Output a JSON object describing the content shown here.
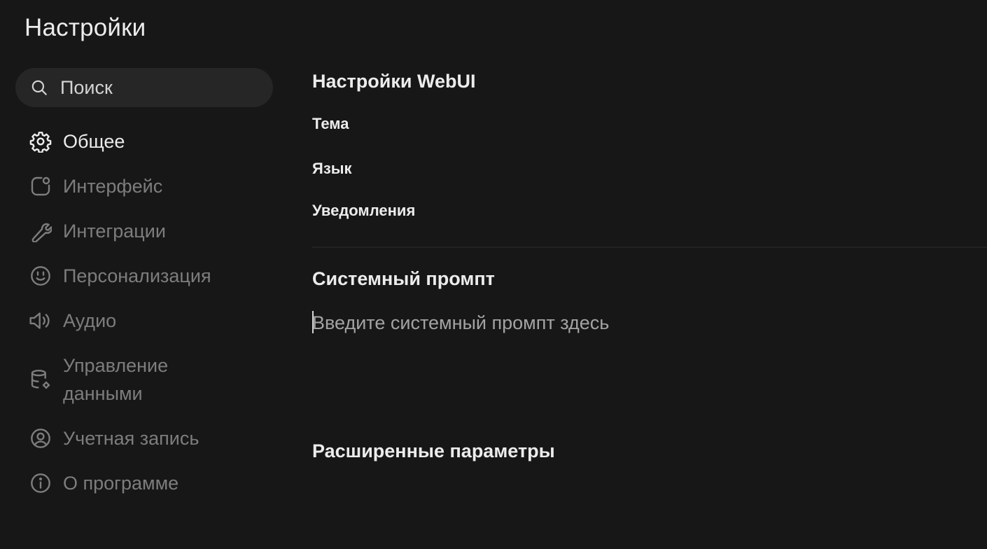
{
  "modal": {
    "title": "Настройки"
  },
  "search": {
    "placeholder": "Поиск",
    "icon": "search-icon"
  },
  "sidebar": {
    "items": [
      {
        "id": "general",
        "label": "Общее",
        "icon": "gear-icon",
        "active": true
      },
      {
        "id": "interface",
        "label": "Интерфейс",
        "icon": "interface-icon",
        "active": false
      },
      {
        "id": "integrations",
        "label": "Интеграции",
        "icon": "wrench-icon",
        "active": false
      },
      {
        "id": "personalization",
        "label": "Персонализация",
        "icon": "face-icon",
        "active": false
      },
      {
        "id": "audio",
        "label": "Аудио",
        "icon": "speaker-icon",
        "active": false
      },
      {
        "id": "data",
        "label": "Управление данными",
        "icon": "database-gear-icon",
        "active": false
      },
      {
        "id": "account",
        "label": "Учетная запись",
        "icon": "user-circle-icon",
        "active": false
      },
      {
        "id": "about",
        "label": "О программе",
        "icon": "info-icon",
        "active": false
      }
    ]
  },
  "main": {
    "webui_section": {
      "title": "Настройки WebUI",
      "theme_label": "Тема",
      "language_label": "Язык",
      "notifications_label": "Уведомления"
    },
    "system_prompt": {
      "title": "Системный промпт",
      "placeholder": "Введите системный промпт здесь",
      "value": ""
    },
    "advanced": {
      "title": "Расширенные параметры"
    }
  },
  "colors": {
    "background": "#171717",
    "search_bg": "#262626",
    "text_active": "#ececec",
    "text_inactive": "#7d7d7d",
    "divider": "#232323"
  }
}
